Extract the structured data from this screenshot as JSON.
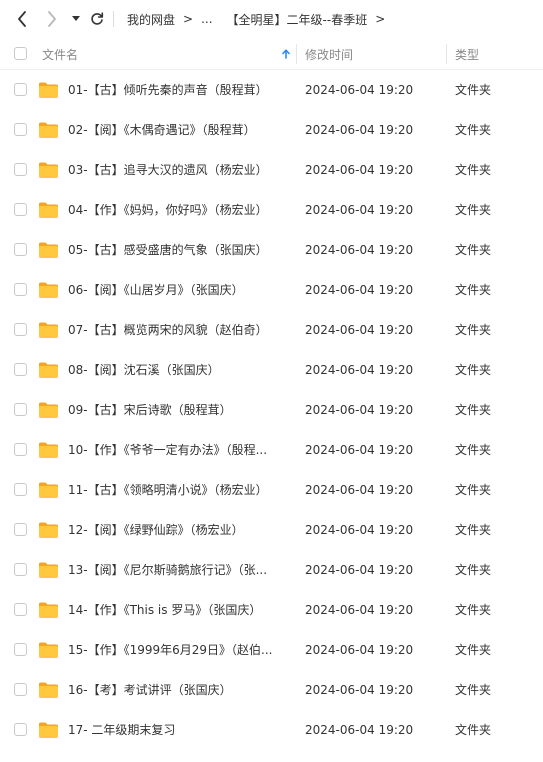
{
  "nav": {
    "back_icon": "chevron-left-icon",
    "forward_icon": "chevron-right-icon",
    "history_icon": "caret-down-icon",
    "refresh_icon": "refresh-icon"
  },
  "breadcrumb": {
    "root": "我的网盘",
    "ellipsis": "...",
    "current": "【全明星】二年级--春季班",
    "separator": ">"
  },
  "table": {
    "headers": {
      "name": "文件名",
      "modified": "修改时间",
      "type": "类型"
    },
    "sort_icon": "arrow-up-icon",
    "rows": [
      {
        "name": "01-【古】倾听先秦的声音（殷程茸）",
        "modified": "2024-06-04 19:20",
        "type": "文件夹"
      },
      {
        "name": "02-【阅】《木偶奇遇记》（殷程茸）",
        "modified": "2024-06-04 19:20",
        "type": "文件夹"
      },
      {
        "name": "03-【古】追寻大汉的遗风（杨宏业）",
        "modified": "2024-06-04 19:20",
        "type": "文件夹"
      },
      {
        "name": "04-【作】《妈妈，你好吗》（杨宏业）",
        "modified": "2024-06-04 19:20",
        "type": "文件夹"
      },
      {
        "name": "05-【古】感受盛唐的气象（张国庆）",
        "modified": "2024-06-04 19:20",
        "type": "文件夹"
      },
      {
        "name": "06-【阅】《山居岁月》（张国庆）",
        "modified": "2024-06-04 19:20",
        "type": "文件夹"
      },
      {
        "name": "07-【古】概览两宋的风貌（赵伯奇）",
        "modified": "2024-06-04 19:20",
        "type": "文件夹"
      },
      {
        "name": "08-【阅】沈石溪（张国庆）",
        "modified": "2024-06-04 19:20",
        "type": "文件夹"
      },
      {
        "name": "09-【古】宋后诗歌（殷程茸）",
        "modified": "2024-06-04 19:20",
        "type": "文件夹"
      },
      {
        "name": "10-【作】《爷爷一定有办法》（殷程...",
        "modified": "2024-06-04 19:20",
        "type": "文件夹"
      },
      {
        "name": "11-【古】《领略明清小说》（杨宏业）",
        "modified": "2024-06-04 19:20",
        "type": "文件夹"
      },
      {
        "name": "12-【阅】《绿野仙踪》（杨宏业）",
        "modified": "2024-06-04 19:20",
        "type": "文件夹"
      },
      {
        "name": "13-【阅】《尼尔斯骑鹅旅行记》（张...",
        "modified": "2024-06-04 19:20",
        "type": "文件夹"
      },
      {
        "name": "14-【作】《This is 罗马》（张国庆）",
        "modified": "2024-06-04 19:20",
        "type": "文件夹"
      },
      {
        "name": "15-【作】《1999年6月29日》（赵伯...",
        "modified": "2024-06-04 19:20",
        "type": "文件夹"
      },
      {
        "name": "16-【考】考试讲评（张国庆）",
        "modified": "2024-06-04 19:20",
        "type": "文件夹"
      },
      {
        "name": "17- 二年级期末复习",
        "modified": "2024-06-04 19:20",
        "type": "文件夹"
      }
    ]
  },
  "colors": {
    "folder": "#FFC83D",
    "folder_tab": "#F5A524",
    "sort_arrow": "#2f8cf5"
  }
}
